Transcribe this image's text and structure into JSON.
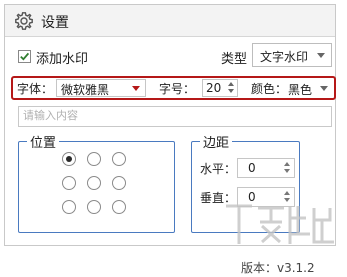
{
  "window": {
    "title": "设置"
  },
  "watermark_options": {
    "add_watermark_label": "添加水印",
    "add_watermark_checked": true,
    "type_label": "类型",
    "type_value": "文字水印"
  },
  "font_row": {
    "font_label": "字体：",
    "font_value": "微软雅黑",
    "size_label": "字号：",
    "size_value": "20",
    "color_label": "颜色：",
    "color_value": "黑色"
  },
  "text_input": {
    "placeholder": "请输入内容",
    "value": ""
  },
  "position_group": {
    "legend": "位置",
    "rows": 3,
    "cols": 3,
    "selected_index": 0
  },
  "margin_group": {
    "legend": "边距",
    "horizontal_label": "水平：",
    "horizontal_value": "0",
    "vertical_label": "垂直：",
    "vertical_value": "0"
  },
  "footer": {
    "version": "版本：v3.1.2"
  },
  "colors": {
    "highlight": "#b51818",
    "group_border": "#4a7ac0",
    "titlebar_bg": "#f3f3f3"
  },
  "icons": {
    "title": "gear-icon",
    "checkbox": "checkmark-icon"
  }
}
